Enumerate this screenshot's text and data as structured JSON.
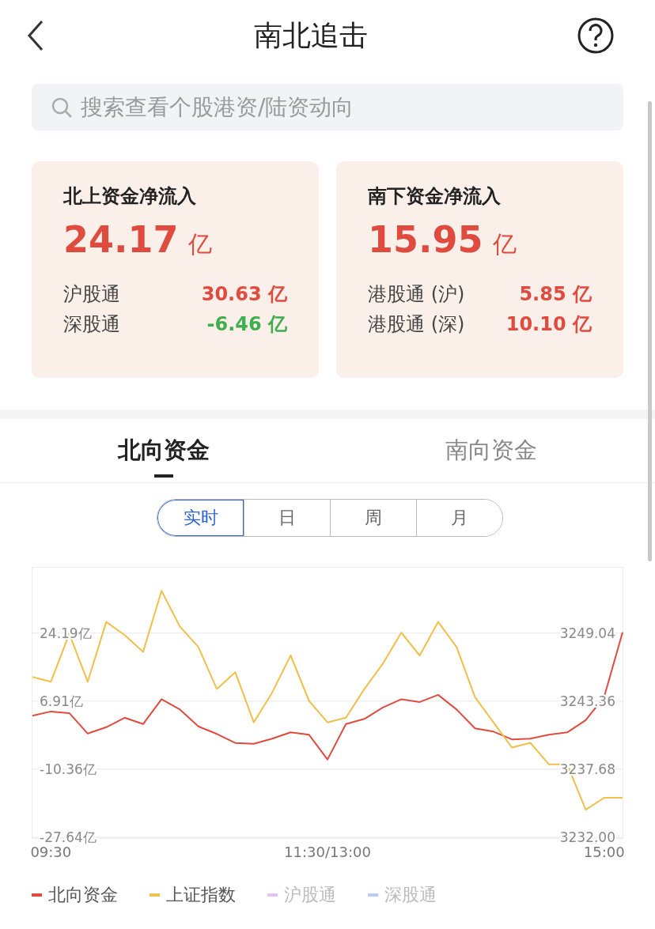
{
  "header": {
    "title": "南北追击"
  },
  "search": {
    "placeholder": "搜索查看个股港资/陆资动向"
  },
  "cards": [
    {
      "title": "北上资金净流入",
      "amount": "24.17",
      "unit": "亿",
      "rows": [
        {
          "label": "沪股通",
          "value": "30.63 亿",
          "color": "#e04b3f"
        },
        {
          "label": "深股通",
          "value": "-6.46 亿",
          "color": "#3fae4f"
        }
      ]
    },
    {
      "title": "南下资金净流入",
      "amount": "15.95",
      "unit": "亿",
      "rows": [
        {
          "label": "港股通 (沪)",
          "value": "5.85 亿",
          "color": "#e04b3f"
        },
        {
          "label": "港股通 (深)",
          "value": "10.10 亿",
          "color": "#e04b3f"
        }
      ]
    }
  ],
  "tabs": [
    {
      "label": "北向资金",
      "selected": true
    },
    {
      "label": "南向资金",
      "selected": false
    }
  ],
  "periods": [
    {
      "label": "实时",
      "selected": true
    },
    {
      "label": "日",
      "selected": false
    },
    {
      "label": "周",
      "selected": false
    },
    {
      "label": "月",
      "selected": false
    }
  ],
  "chart": {
    "chart_data": {
      "type": "line",
      "categories": [
        null,
        "09:30",
        null,
        null,
        null,
        null,
        null,
        null,
        null,
        null,
        null,
        null,
        null,
        null,
        null,
        null,
        "11:30/13:00",
        null,
        null,
        null,
        null,
        null,
        null,
        null,
        null,
        null,
        null,
        null,
        null,
        null,
        null,
        "15:00",
        null
      ],
      "grid": true,
      "ylim": [
        -27.64,
        41.0
      ],
      "yticks": [
        {
          "value": 24.19,
          "label": "24.19亿"
        },
        {
          "value": 6.91,
          "label": "6.91亿"
        },
        {
          "value": -10.36,
          "label": "-10.36亿"
        },
        {
          "value": -27.64,
          "label": "-27.64亿"
        }
      ],
      "y2lim": [
        3232.0,
        3254.6
      ],
      "y2ticks": [
        {
          "value": 3249.04,
          "label": "3249.04"
        },
        {
          "value": 3243.36,
          "label": "3243.36"
        },
        {
          "value": 3237.68,
          "label": "3237.68"
        },
        {
          "value": 3232.0,
          "label": "3232.00"
        }
      ],
      "series": [
        {
          "name": "北向资金",
          "color": "#e04b3f",
          "values": [
            3.2,
            4.3,
            3.9,
            -1.3,
            0.3,
            2.7,
            1.1,
            7.4,
            4.8,
            0.5,
            -1.4,
            -3.7,
            -3.9,
            -2.6,
            -1.0,
            -1.6,
            -7.9,
            1.1,
            2.4,
            5.3,
            7.4,
            6.7,
            8.5,
            4.8,
            0.0,
            -0.8,
            -2.8,
            -2.6,
            -1.6,
            -1.0,
            2.1,
            8.0,
            24.4
          ]
        },
        {
          "name": "上证指数",
          "color": "#f0bf4c",
          "axis": "y2",
          "values": [
            3245.4,
            3245.0,
            3249.0,
            3245.0,
            3250.0,
            3248.9,
            3247.5,
            3252.6,
            3249.6,
            3247.9,
            3244.4,
            3245.8,
            3241.6,
            3244.1,
            3247.2,
            3243.4,
            3241.6,
            3242.0,
            3244.4,
            3246.5,
            3249.1,
            3247.2,
            3250.0,
            3247.9,
            3243.7,
            3241.6,
            3239.5,
            3239.9,
            3238.1,
            3238.1,
            3234.3,
            3235.3,
            3235.3
          ]
        }
      ]
    },
    "legend": [
      {
        "label": "沪股通",
        "color": "#e3c4ee",
        "on": false
      },
      {
        "label": "深股通",
        "color": "#b9cdf0",
        "on": false
      }
    ]
  }
}
